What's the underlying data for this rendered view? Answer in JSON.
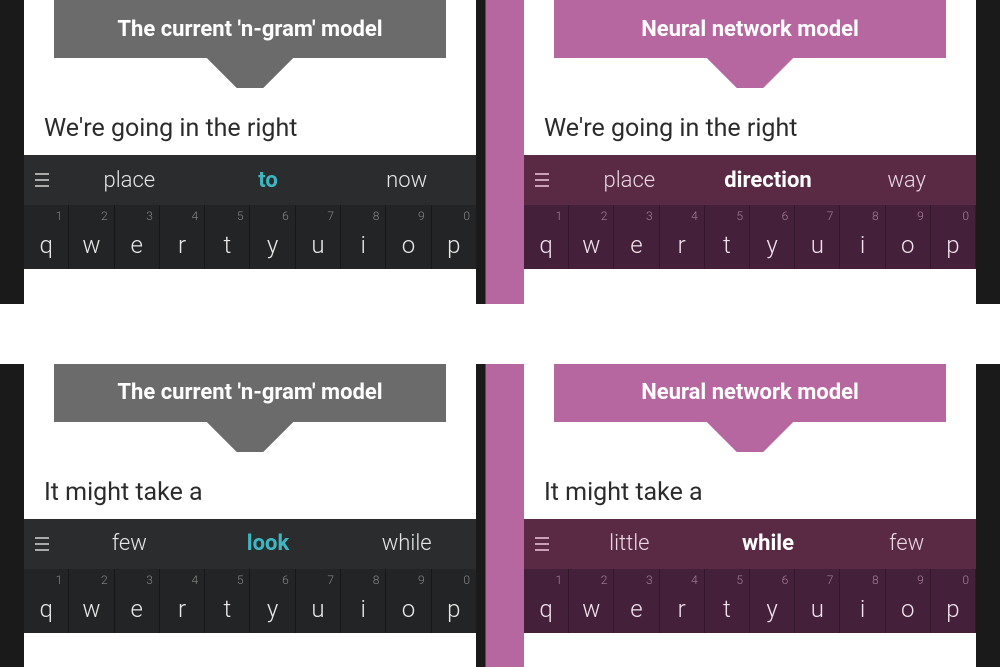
{
  "panels": [
    {
      "banner_class": "gray",
      "banner_text": "The current 'n-gram' model",
      "typed": "We're going in the right",
      "sugg_class": "dark",
      "center_class": "teal",
      "suggestions": [
        "place",
        "to",
        "now"
      ],
      "kb_class": "dark",
      "left_edge": "",
      "right_edge": "purple",
      "keys": [
        {
          "l": "q",
          "n": "1"
        },
        {
          "l": "w",
          "n": "2"
        },
        {
          "l": "e",
          "n": "3"
        },
        {
          "l": "r",
          "n": "4"
        },
        {
          "l": "t",
          "n": "5"
        },
        {
          "l": "y",
          "n": "6"
        },
        {
          "l": "u",
          "n": "7"
        },
        {
          "l": "i",
          "n": "8"
        },
        {
          "l": "o",
          "n": "9"
        },
        {
          "l": "p",
          "n": "0"
        }
      ]
    },
    {
      "banner_class": "pink",
      "banner_text": "Neural network model",
      "typed": "We're going in the right",
      "sugg_class": "wine",
      "center_class": "white",
      "suggestions": [
        "place",
        "direction",
        "way"
      ],
      "kb_class": "wine",
      "left_edge": "purple",
      "right_edge": "",
      "keys": [
        {
          "l": "q",
          "n": "1"
        },
        {
          "l": "w",
          "n": "2"
        },
        {
          "l": "e",
          "n": "3"
        },
        {
          "l": "r",
          "n": "4"
        },
        {
          "l": "t",
          "n": "5"
        },
        {
          "l": "y",
          "n": "6"
        },
        {
          "l": "u",
          "n": "7"
        },
        {
          "l": "i",
          "n": "8"
        },
        {
          "l": "o",
          "n": "9"
        },
        {
          "l": "p",
          "n": "0"
        }
      ]
    },
    {
      "banner_class": "gray",
      "banner_text": "The current 'n-gram' model",
      "typed": "It might take a",
      "sugg_class": "dark",
      "center_class": "teal",
      "suggestions": [
        "few",
        "look",
        "while"
      ],
      "kb_class": "dark",
      "left_edge": "",
      "right_edge": "purple",
      "keys": [
        {
          "l": "q",
          "n": "1"
        },
        {
          "l": "w",
          "n": "2"
        },
        {
          "l": "e",
          "n": "3"
        },
        {
          "l": "r",
          "n": "4"
        },
        {
          "l": "t",
          "n": "5"
        },
        {
          "l": "y",
          "n": "6"
        },
        {
          "l": "u",
          "n": "7"
        },
        {
          "l": "i",
          "n": "8"
        },
        {
          "l": "o",
          "n": "9"
        },
        {
          "l": "p",
          "n": "0"
        }
      ]
    },
    {
      "banner_class": "pink",
      "banner_text": "Neural network model",
      "typed": "It might take a",
      "sugg_class": "wine",
      "center_class": "white",
      "suggestions": [
        "little",
        "while",
        "few"
      ],
      "kb_class": "wine",
      "left_edge": "purple",
      "right_edge": "",
      "keys": [
        {
          "l": "q",
          "n": "1"
        },
        {
          "l": "w",
          "n": "2"
        },
        {
          "l": "e",
          "n": "3"
        },
        {
          "l": "r",
          "n": "4"
        },
        {
          "l": "t",
          "n": "5"
        },
        {
          "l": "y",
          "n": "6"
        },
        {
          "l": "u",
          "n": "7"
        },
        {
          "l": "i",
          "n": "8"
        },
        {
          "l": "o",
          "n": "9"
        },
        {
          "l": "p",
          "n": "0"
        }
      ]
    }
  ]
}
